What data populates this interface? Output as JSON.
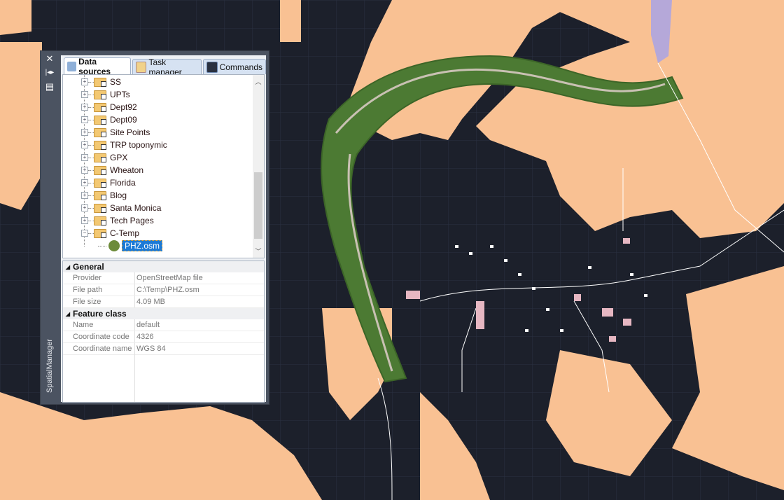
{
  "panel": {
    "title": "SpatialManager",
    "icons": [
      "close-icon",
      "dock-toggle-icon",
      "panel-layout-icon"
    ],
    "tabs": [
      {
        "label": "Data sources",
        "icon": "database-icon",
        "active": true
      },
      {
        "label": "Task manager",
        "icon": "task-list-icon",
        "active": false
      },
      {
        "label": "Commands",
        "icon": "console-icon",
        "active": false
      }
    ],
    "tree": {
      "items": [
        "SS",
        "UPTs",
        "Dept92",
        "Dept09",
        "Site Points",
        "TRP toponymic",
        "GPX",
        "Wheaton",
        "Florida",
        "Blog",
        "Santa Monica",
        "Tech Pages",
        "C-Temp"
      ],
      "expanded": "C-Temp",
      "child": "PHZ.osm"
    },
    "properties": [
      {
        "category": "General",
        "rows": [
          {
            "key": "Provider",
            "value": "OpenStreetMap file"
          },
          {
            "key": "File path",
            "value": "C:\\Temp\\PHZ.osm"
          },
          {
            "key": "File size",
            "value": "4.09 MB"
          }
        ]
      },
      {
        "category": "Feature class",
        "rows": [
          {
            "key": "Name",
            "value": "default"
          },
          {
            "key": "Coordinate code",
            "value": "4326"
          },
          {
            "key": "Coordinate name",
            "value": "WGS 84"
          }
        ]
      }
    ]
  },
  "colors": {
    "map_background": "#1c202b",
    "landuse": "#f9c193",
    "imagery": "#4c7a33",
    "selection": "#1c7ad6"
  }
}
